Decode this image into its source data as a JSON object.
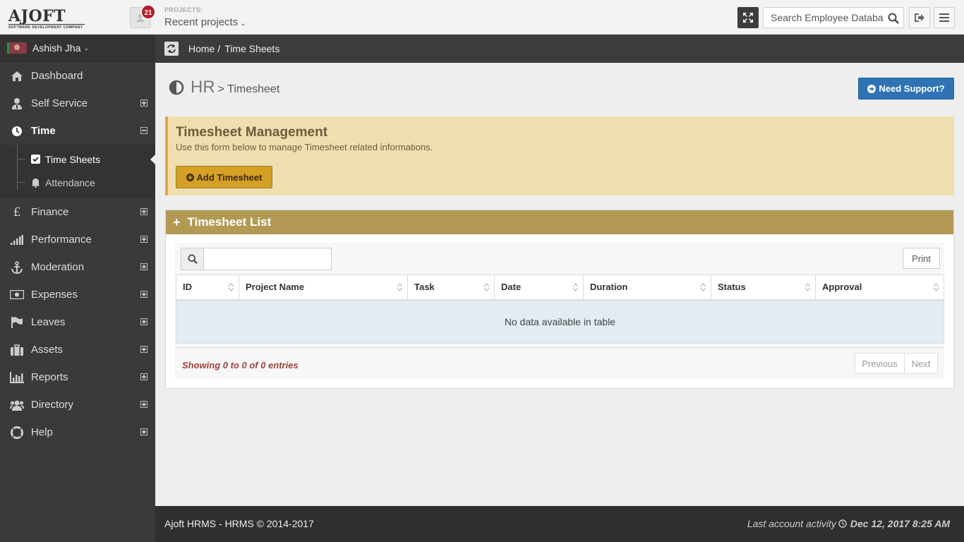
{
  "header": {
    "logo_text": "AJOFT",
    "logo_subtext": "SOFTWARE DEVELOPMENT COMPANY",
    "notification_count": "21",
    "projects_label": "PROJECTS:",
    "projects_selected": "Recent projects",
    "search_placeholder": "Search Employee Database"
  },
  "sidebar": {
    "user_name": "Ashish Jha",
    "items": [
      {
        "label": "Dashboard",
        "icon": "home-icon"
      },
      {
        "label": "Self Service",
        "icon": "user-tie-icon"
      },
      {
        "label": "Time",
        "icon": "clock-icon",
        "expanded": true
      },
      {
        "label": "Finance",
        "icon": "pound-icon"
      },
      {
        "label": "Performance",
        "icon": "signal-icon"
      },
      {
        "label": "Moderation",
        "icon": "anchor-icon"
      },
      {
        "label": "Expenses",
        "icon": "money-icon"
      },
      {
        "label": "Leaves",
        "icon": "flag-icon"
      },
      {
        "label": "Assets",
        "icon": "briefcase-icon"
      },
      {
        "label": "Reports",
        "icon": "bar-chart-icon"
      },
      {
        "label": "Directory",
        "icon": "users-icon"
      },
      {
        "label": "Help",
        "icon": "life-ring-icon"
      }
    ],
    "time_subitems": [
      {
        "label": "Time Sheets",
        "icon": "check-square-icon",
        "active": true
      },
      {
        "label": "Attendance",
        "icon": "bell-icon"
      }
    ]
  },
  "breadcrumb": {
    "home": "Home",
    "separator": "/",
    "current": "Time Sheets"
  },
  "page": {
    "title": "HR",
    "subtitle": "> Timesheet",
    "support_button": "Need Support?"
  },
  "callout": {
    "title": "Timesheet Management",
    "text": "Use this form below to manage Timesheet related informations.",
    "add_button": "Add Timesheet"
  },
  "list": {
    "title": "Timesheet List",
    "print_button": "Print",
    "columns": [
      "ID",
      "Project Name",
      "Task",
      "Date",
      "Duration",
      "Status",
      "Approval"
    ],
    "empty_message": "No data available in table",
    "showing": "Showing 0 to 0 of 0 entries",
    "prev": "Previous",
    "next": "Next"
  },
  "footer": {
    "copyright": "Ajoft HRMS - HRMS © 2014-2017",
    "activity_label": "Last account activity",
    "activity_date": "Dec 12, 2017 8:25 AM"
  },
  "colors": {
    "accent_blue": "#2f73b5",
    "callout_bg": "#efdfb0",
    "panel_head": "#b29a55",
    "add_button": "#d5a124",
    "badge": "#b01e2b"
  }
}
